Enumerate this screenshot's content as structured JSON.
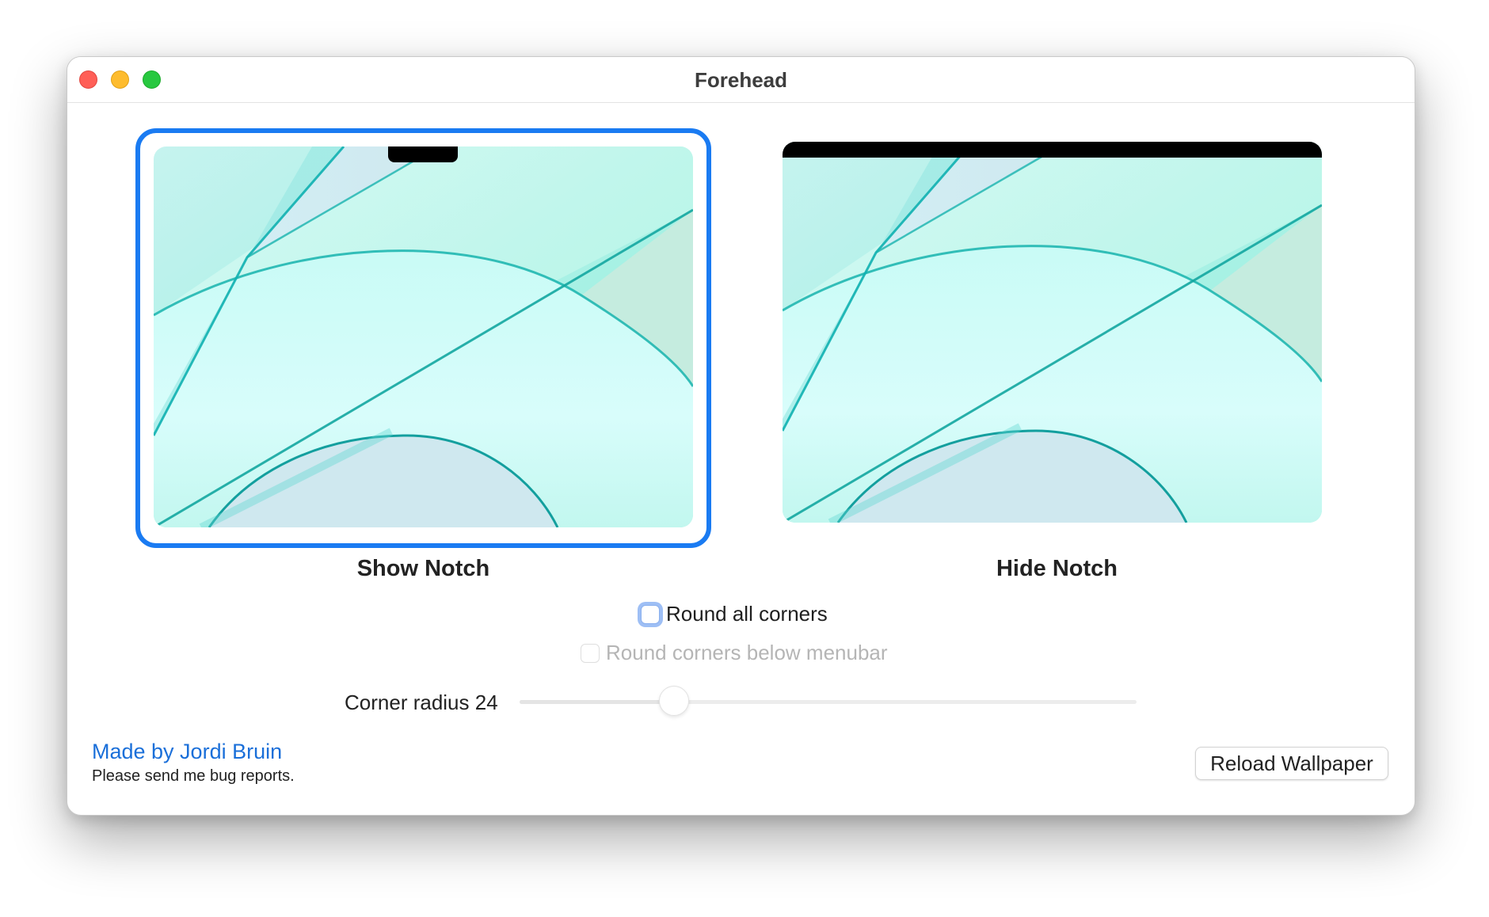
{
  "window": {
    "title": "Forehead",
    "traffic_lights": [
      {
        "name": "close",
        "color": "#ff5f57"
      },
      {
        "name": "minimize",
        "color": "#febc2e"
      },
      {
        "name": "zoom",
        "color": "#28c840"
      }
    ]
  },
  "options": {
    "show_notch": {
      "label": "Show Notch",
      "selected": true
    },
    "hide_notch": {
      "label": "Hide Notch",
      "selected": false
    }
  },
  "checkboxes": {
    "round_all_corners": {
      "label": "Round all corners",
      "checked": false,
      "enabled": true
    },
    "round_below_menubar": {
      "label": "Round corners below menubar",
      "checked": false,
      "enabled": false
    }
  },
  "corner_radius": {
    "label": "Corner radius 24",
    "value": 24,
    "level": 0.25
  },
  "footer": {
    "credit_link": "Made by Jordi Bruin",
    "credit_sub": "Please send me bug reports.",
    "reload_button": "Reload Wallpaper"
  },
  "colors": {
    "accent": "#1a7bf2",
    "link": "#1a6fd9",
    "wallpaper_light": "#d6fbf6",
    "wallpaper_teal": "#00b4a8"
  }
}
